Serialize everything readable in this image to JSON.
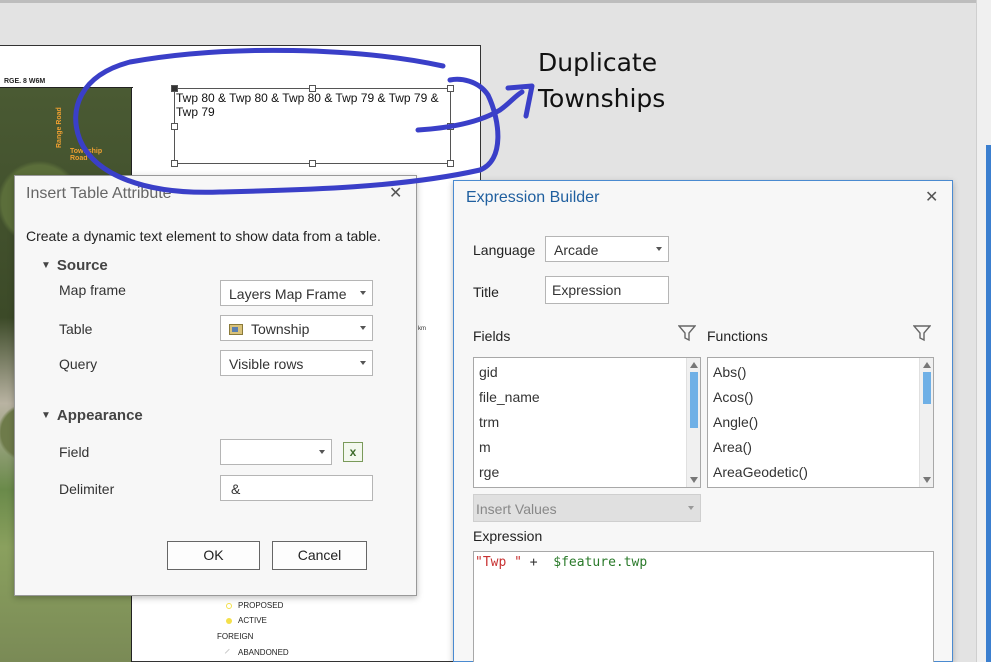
{
  "layout": {
    "map_header": "RGE. 8 W6M",
    "road_labels": [
      "Range Road",
      "Township Road"
    ],
    "selected_text": "Twp 80 & Twp 80 & Twp 80 & Twp 79 & Twp 79 & Twp 79",
    "scale_unit": "km",
    "legend": [
      {
        "label": "PROPOSED",
        "color": "#f4e04a"
      },
      {
        "label": "ACTIVE",
        "color": "#f4e04a"
      },
      {
        "label": "FOREIGN",
        "color": ""
      },
      {
        "label": "ABANDONED",
        "color": "#cccccc"
      }
    ]
  },
  "annotation": {
    "line1": "Duplicate",
    "line2": "Townships",
    "ink_color": "#3a3fc8"
  },
  "insert_dialog": {
    "title": "Insert Table Attribute",
    "description": "Create a dynamic text element to show data from a table.",
    "source_section": "Source",
    "map_frame_label": "Map frame",
    "map_frame_value": "Layers Map Frame",
    "table_label": "Table",
    "table_value": "Township",
    "query_label": "Query",
    "query_value": "Visible rows",
    "appearance_section": "Appearance",
    "field_label": "Field",
    "field_value": "",
    "delimiter_label": "Delimiter",
    "delimiter_value": "&",
    "ok_label": "OK",
    "cancel_label": "Cancel"
  },
  "expression_builder": {
    "title": "Expression Builder",
    "language_label": "Language",
    "language_value": "Arcade",
    "title_label": "Title",
    "title_value": "Expression",
    "fields_label": "Fields",
    "fields": [
      "gid",
      "file_name",
      "trm",
      "m",
      "rge"
    ],
    "functions_label": "Functions",
    "functions": [
      "Abs()",
      "Acos()",
      "Angle()",
      "Area()",
      "AreaGeodetic()"
    ],
    "insert_values_label": "Insert Values",
    "expression_label": "Expression",
    "expression_string": "\"Twp \"",
    "expression_operator": " +  ",
    "expression_variable": "$feature.twp"
  },
  "colors": {
    "accent": "#4a8ad0",
    "title_blue": "#1f5f9f",
    "scroll_thumb": "#6fb0e6"
  }
}
